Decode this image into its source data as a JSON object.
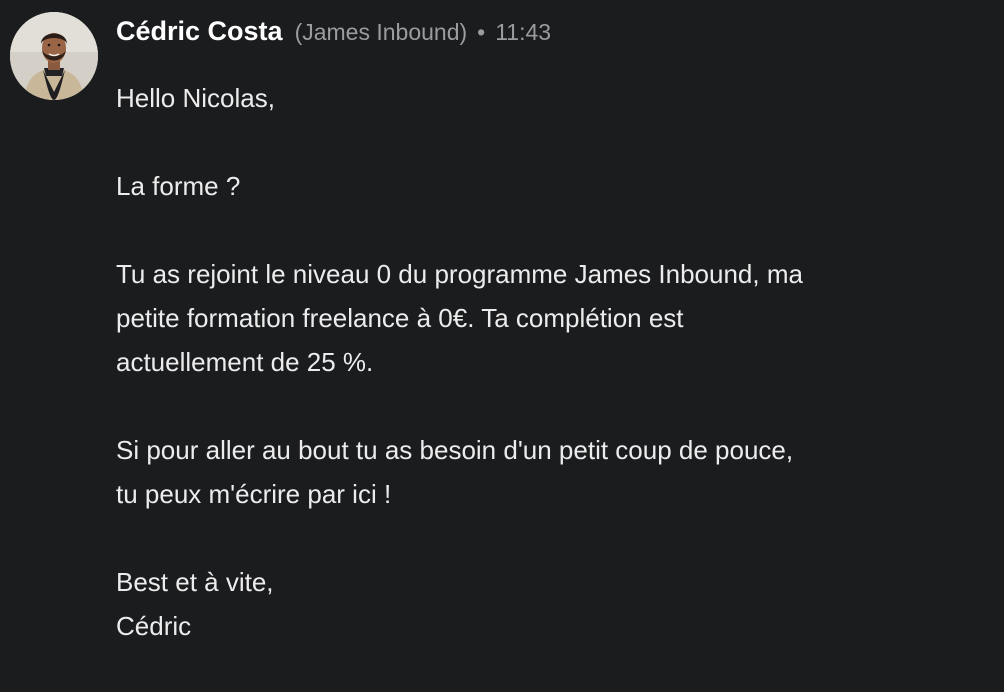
{
  "message": {
    "sender": {
      "name": "Cédric Costa",
      "company": "(James Inbound)",
      "separator": "•",
      "time": "11:43",
      "avatar_icon": "profile-photo"
    },
    "paragraphs": [
      [
        "Hello Nicolas,"
      ],
      [
        "La forme ?"
      ],
      [
        "Tu as rejoint le niveau 0 du programme James Inbound, ma",
        "petite formation freelance à 0€. Ta complétion est",
        "actuellement de 25 %."
      ],
      [
        "Si pour aller au bout tu as besoin d'un petit coup de pouce,",
        "tu peux m'écrire par ici !"
      ],
      [
        "Best et à vite,",
        "Cédric"
      ]
    ]
  },
  "colors": {
    "background": "#1b1c1e",
    "name": "#ffffff",
    "meta": "#9a9ca0",
    "text": "#ececec"
  }
}
